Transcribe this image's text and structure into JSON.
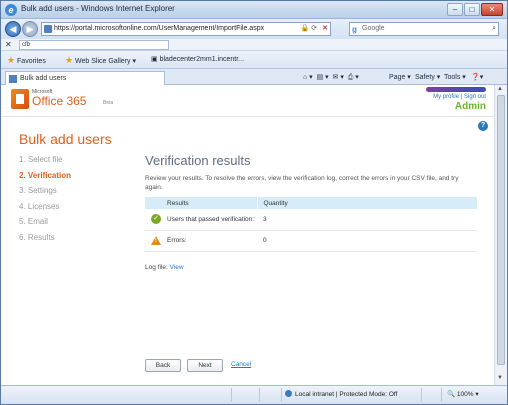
{
  "browser": {
    "window_title": "Bulk add users - Windows Internet Explorer",
    "address": "https://portal.microsoftonline.com/UserManagement/ImportFile.aspx",
    "search_engine": "Google",
    "find_text": "cfb",
    "favorites_label": "Favorites",
    "favorites_items": [
      "Web Slice Gallery ▾",
      "bladecenter2mm1.incentr..."
    ],
    "command_items": [
      "Page ▾",
      "Safety ▾",
      "Tools ▾"
    ],
    "tab_title": "Bulk add users",
    "status_zone": "Local intranet | Protected Mode: Off",
    "zoom": "100%"
  },
  "portal": {
    "brand_small": "Microsoft",
    "brand": "Office 365",
    "beta": "Beta",
    "user_links": "My profile | Sign out",
    "role": "Admin",
    "help": "?"
  },
  "page": {
    "title": "Bulk add users",
    "steps": [
      {
        "label": "1.  Select file",
        "active": false
      },
      {
        "label": "2.  Verification",
        "active": true
      },
      {
        "label": "3.  Settings",
        "active": false
      },
      {
        "label": "4.  Licenses",
        "active": false
      },
      {
        "label": "5.  Email",
        "active": false
      },
      {
        "label": "6.  Results",
        "active": false
      }
    ],
    "verification": {
      "heading": "Verification results",
      "description": "Review your results. To resolve the errors, view the verification log, correct the errors in your CSV file, and try again.",
      "columns": [
        "Results",
        "Quantity"
      ],
      "rows": [
        {
          "label": "Users that passed verification:",
          "value": "3",
          "status": "ok"
        },
        {
          "label": "Errors:",
          "value": "0",
          "status": "warning"
        }
      ],
      "log_label": "Log file:",
      "log_link": "View"
    },
    "buttons": {
      "back": "Back",
      "next": "Next",
      "cancel": "Cancel"
    }
  },
  "colors": {
    "accent": "#e0601b",
    "link": "#2a7ab8",
    "admin": "#6ab42d",
    "header_row": "#d6ecf8"
  }
}
